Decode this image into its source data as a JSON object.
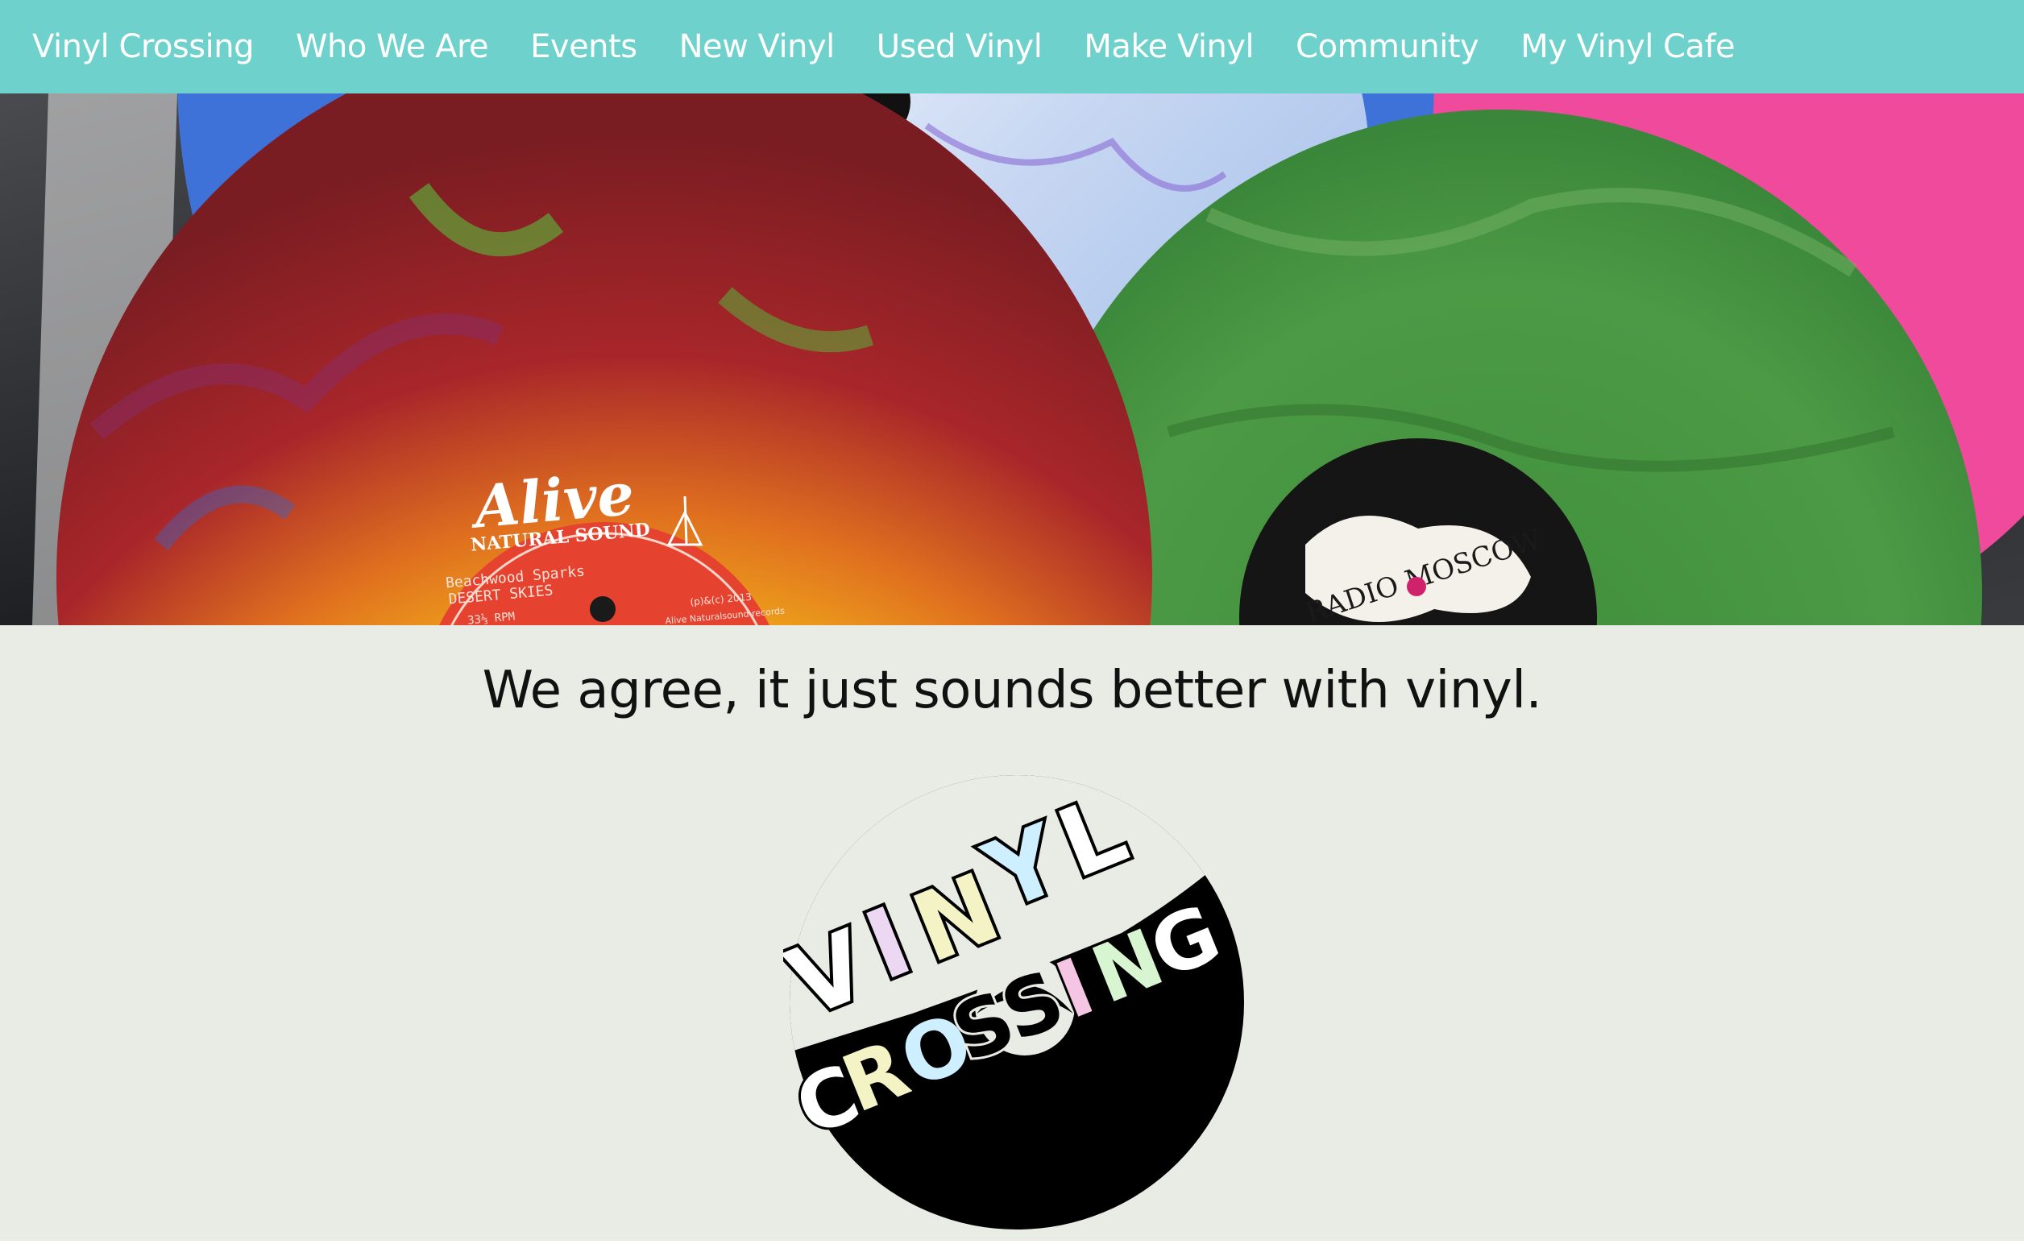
{
  "nav": {
    "items": [
      {
        "label": "Vinyl Crossing",
        "name": "nav-home-link"
      },
      {
        "label": "Who We Are",
        "name": "nav-who-we-are"
      },
      {
        "label": "Events",
        "name": "nav-events"
      },
      {
        "label": "New Vinyl",
        "name": "nav-new-vinyl"
      },
      {
        "label": "Used Vinyl",
        "name": "nav-used-vinyl"
      },
      {
        "label": "Make Vinyl",
        "name": "nav-make-vinyl"
      },
      {
        "label": "Community",
        "name": "nav-community"
      },
      {
        "label": "My Vinyl Cafe",
        "name": "nav-my-vinyl-cafe"
      }
    ]
  },
  "hero": {
    "label_brand": "Alive",
    "label_sub": "NATURAL SOUND",
    "label_artist": "Beachwood Sparks",
    "label_title": "DESERT SKIES",
    "label_rpm": "33⅓ RPM",
    "label_copyright": "(p)&(c) 2013",
    "label_company": "Alive Naturalsound records",
    "green_label_text": "RADIO MOSCOW"
  },
  "tagline": "We agree, it just sounds better with vinyl.",
  "logo": {
    "word1": [
      "V",
      "I",
      "N",
      "Y",
      "L"
    ],
    "word2": [
      "C",
      "R",
      "O",
      "S",
      "S",
      "I",
      "N",
      "G"
    ]
  },
  "colors": {
    "nav_bg": "#6fd1cc",
    "page_bg": "#e9ebe5",
    "text": "#111111"
  }
}
